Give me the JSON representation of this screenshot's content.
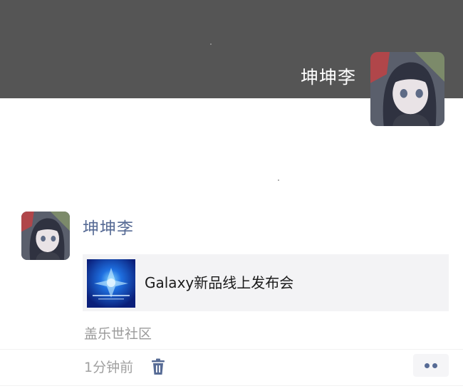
{
  "cover": {
    "background_color": "#555555",
    "username": "坤坤李",
    "avatar_icon": "anime-girl-avatar"
  },
  "post": {
    "author": "坤坤李",
    "author_color": "#576b95",
    "avatar_icon": "anime-girl-avatar",
    "shared_link": {
      "title": "Galaxy新品线上发布会",
      "thumbnail_icon": "galaxy-launch-thumbnail"
    },
    "source": "盖乐世社区",
    "time": "1分钟前",
    "delete_icon": "trash-icon",
    "more_icon": "more-dots-icon"
  }
}
